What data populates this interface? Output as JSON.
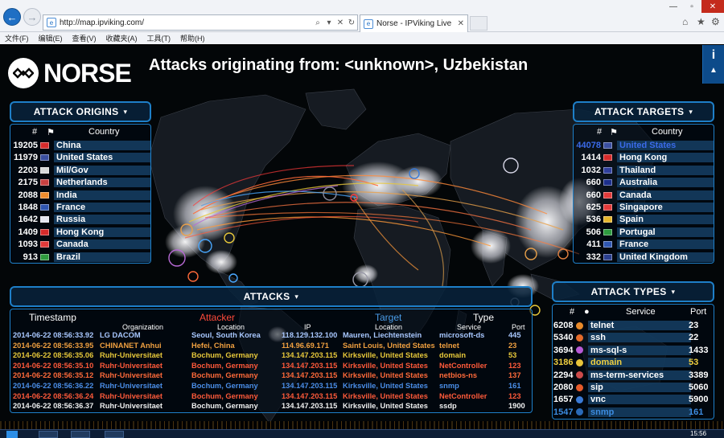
{
  "browser": {
    "address": "http://map.ipviking.com/",
    "tab_title": "Norse - IPViking Live",
    "menu": [
      "文件(F)",
      "编辑(E)",
      "查看(V)",
      "收藏夹(A)",
      "工具(T)",
      "帮助(H)"
    ]
  },
  "app": {
    "logo_text": "NORSE",
    "headline": "Attacks originating from: <unknown>, Uzbekistan",
    "info_label": "i"
  },
  "origins": {
    "title": "ATTACK ORIGINS",
    "col_count": "#",
    "col_country": "Country",
    "rows": [
      {
        "count": "19205",
        "country": "China",
        "flag": "#d62b2b"
      },
      {
        "count": "11979",
        "country": "United States",
        "flag": "#3a4fa0"
      },
      {
        "count": "2203",
        "country": "Mil/Gov",
        "flag": "#d9d9d9"
      },
      {
        "count": "2175",
        "country": "Netherlands",
        "flag": "#c84040"
      },
      {
        "count": "2088",
        "country": "India",
        "flag": "#f08c2c"
      },
      {
        "count": "1848",
        "country": "France",
        "flag": "#2f56b0"
      },
      {
        "count": "1642",
        "country": "Russia",
        "flag": "#e6e6f0"
      },
      {
        "count": "1409",
        "country": "Hong Kong",
        "flag": "#d62b2b"
      },
      {
        "count": "1093",
        "country": "Canada",
        "flag": "#e23a3a"
      },
      {
        "count": "913",
        "country": "Brazil",
        "flag": "#2e9a3e"
      }
    ]
  },
  "targets": {
    "title": "ATTACK TARGETS",
    "col_count": "#",
    "col_country": "Country",
    "rows": [
      {
        "count": "44078",
        "country": "United States",
        "flag": "#3a4fa0",
        "highlight": true
      },
      {
        "count": "1414",
        "country": "Hong Kong",
        "flag": "#d62b2b"
      },
      {
        "count": "1032",
        "country": "Thailand",
        "flag": "#2f3f9c"
      },
      {
        "count": "660",
        "country": "Australia",
        "flag": "#1c2f8c"
      },
      {
        "count": "660",
        "country": "Canada",
        "flag": "#e23a3a"
      },
      {
        "count": "625",
        "country": "Singapore",
        "flag": "#e23a3a"
      },
      {
        "count": "536",
        "country": "Spain",
        "flag": "#e5b52b"
      },
      {
        "count": "506",
        "country": "Portugal",
        "flag": "#2e9a3e"
      },
      {
        "count": "411",
        "country": "France",
        "flag": "#2f56b0"
      },
      {
        "count": "332",
        "country": "United Kingdom",
        "flag": "#2a3f8f"
      }
    ]
  },
  "types": {
    "title": "ATTACK TYPES",
    "col_count": "#",
    "col_service": "Service",
    "col_port": "Port",
    "rows": [
      {
        "count": "6208",
        "service": "telnet",
        "port": "23",
        "dot": "#e88a2a",
        "color": "#ffffff"
      },
      {
        "count": "5340",
        "service": "ssh",
        "port": "22",
        "dot": "#e46a2a",
        "color": "#ffffff"
      },
      {
        "count": "3694",
        "service": "ms-sql-s",
        "port": "1433",
        "dot": "#b85ad6",
        "color": "#ffffff"
      },
      {
        "count": "3186",
        "service": "domain",
        "port": "53",
        "dot": "#e8c43a",
        "color": "#f0d040"
      },
      {
        "count": "2294",
        "service": "ms-term-services",
        "port": "3389",
        "dot": "#cc4a4a",
        "color": "#ffffff"
      },
      {
        "count": "2080",
        "service": "sip",
        "port": "5060",
        "dot": "#e65a2a",
        "color": "#ffffff"
      },
      {
        "count": "1657",
        "service": "vnc",
        "port": "5900",
        "dot": "#3a7ad6",
        "color": "#ffffff"
      },
      {
        "count": "1547",
        "service": "snmp",
        "port": "161",
        "dot": "#2a6ab8",
        "color": "#3d8ce0"
      }
    ]
  },
  "attacks": {
    "title": "ATTACKS",
    "h_timestamp": "Timestamp",
    "h_attacker": "Attacker",
    "h_target": "Target",
    "h_type": "Type",
    "sub_org": "Organization",
    "sub_loc": "Location",
    "sub_ip": "IP",
    "sub_tloc": "Location",
    "sub_service": "Service",
    "sub_port": "Port",
    "rows": [
      {
        "time": "2014-06-22 08:56:33.92",
        "org": "LG DACOM",
        "loc": "Seoul, South Korea",
        "ip": "118.129.132.100",
        "tloc": "Mauren, Liechtenstein",
        "service": "microsoft-ds",
        "port": "445",
        "color": "#a9c8ff"
      },
      {
        "time": "2014-06-22 08:56:33.95",
        "org": "CHINANET Anhui",
        "loc": "Hefei, China",
        "ip": "114.96.69.171",
        "tloc": "Saint Louis, United States",
        "service": "telnet",
        "port": "23",
        "color": "#f0a040"
      },
      {
        "time": "2014-06-22 08:56:35.06",
        "org": "Ruhr-Universitaet",
        "loc": "Bochum, Germany",
        "ip": "134.147.203.115",
        "tloc": "Kirksville, United States",
        "service": "domain",
        "port": "53",
        "color": "#e8c83a"
      },
      {
        "time": "2014-06-22 08:56:35.10",
        "org": "Ruhr-Universitaet",
        "loc": "Bochum, Germany",
        "ip": "134.147.203.115",
        "tloc": "Kirksville, United States",
        "service": "NetController",
        "port": "123",
        "color": "#ff5a3a"
      },
      {
        "time": "2014-06-22 08:56:35.12",
        "org": "Ruhr-Universitaet",
        "loc": "Bochum, Germany",
        "ip": "134.147.203.115",
        "tloc": "Kirksville, United States",
        "service": "netbios-ns",
        "port": "137",
        "color": "#ff6a3a"
      },
      {
        "time": "2014-06-22 08:56:36.22",
        "org": "Ruhr-Universitaet",
        "loc": "Bochum, Germany",
        "ip": "134.147.203.115",
        "tloc": "Kirksville, United States",
        "service": "snmp",
        "port": "161",
        "color": "#4a8ee8"
      },
      {
        "time": "2014-06-22 08:56:36.24",
        "org": "Ruhr-Universitaet",
        "loc": "Bochum, Germany",
        "ip": "134.147.203.115",
        "tloc": "Kirksville, United States",
        "service": "NetController",
        "port": "123",
        "color": "#ff5a3a"
      },
      {
        "time": "2014-06-22 08:56:36.37",
        "org": "Ruhr-Universitaet",
        "loc": "Bochum, Germany",
        "ip": "134.147.203.115",
        "tloc": "Kirksville, United States",
        "service": "ssdp",
        "port": "1900",
        "color": "#f0f0f0"
      }
    ]
  },
  "taskbar": {
    "clock": "15:56"
  },
  "colors": {
    "accent": "#1e7fc8",
    "attacker": "#ff4a3a",
    "target": "#4a9ce8"
  }
}
